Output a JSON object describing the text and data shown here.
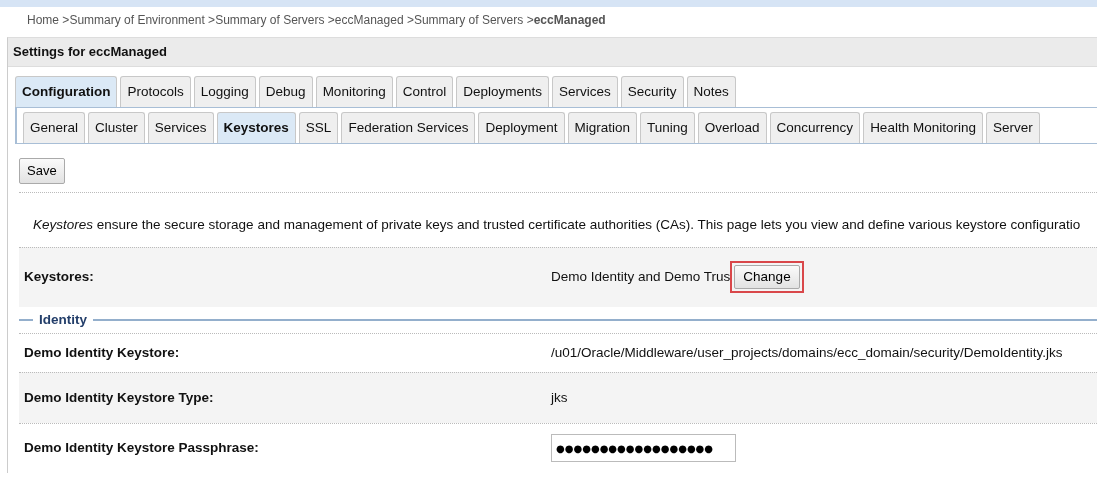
{
  "breadcrumb": [
    {
      "label": "Home",
      "current": false
    },
    {
      "separator": ">",
      "label": "Summary of Environment",
      "current": false
    },
    {
      "separator": ">",
      "label": "Summary of Servers",
      "current": false
    },
    {
      "separator": ">",
      "label": "eccManaged",
      "current": false
    },
    {
      "separator": ">",
      "label": "Summary of Servers",
      "current": false
    },
    {
      "separator": ">",
      "label": "eccManaged",
      "current": true
    }
  ],
  "panel_title": "Settings for eccManaged",
  "tabs": [
    {
      "label": "Configuration",
      "selected": true
    },
    {
      "label": "Protocols",
      "selected": false
    },
    {
      "label": "Logging",
      "selected": false
    },
    {
      "label": "Debug",
      "selected": false
    },
    {
      "label": "Monitoring",
      "selected": false
    },
    {
      "label": "Control",
      "selected": false
    },
    {
      "label": "Deployments",
      "selected": false
    },
    {
      "label": "Services",
      "selected": false
    },
    {
      "label": "Security",
      "selected": false
    },
    {
      "label": "Notes",
      "selected": false
    }
  ],
  "subtabs": [
    {
      "label": "General",
      "selected": false
    },
    {
      "label": "Cluster",
      "selected": false
    },
    {
      "label": "Services",
      "selected": false
    },
    {
      "label": "Keystores",
      "selected": true
    },
    {
      "label": "SSL",
      "selected": false
    },
    {
      "label": "Federation Services",
      "selected": false
    },
    {
      "label": "Deployment",
      "selected": false
    },
    {
      "label": "Migration",
      "selected": false
    },
    {
      "label": "Tuning",
      "selected": false
    },
    {
      "label": "Overload",
      "selected": false
    },
    {
      "label": "Concurrency",
      "selected": false
    },
    {
      "label": "Health Monitoring",
      "selected": false
    },
    {
      "label": "Server",
      "selected": false
    }
  ],
  "save_button": "Save",
  "description": "*Keystores* ensure the secure storage and management of private keys and trusted certificate authorities (CAs). This page lets you view and define various keystore configuratio",
  "keystores": {
    "label": "Keystores:",
    "value": "Demo Identity and Demo Trus",
    "button": "Change",
    "highlighted": true
  },
  "sections": [
    {
      "title": "Identity",
      "rows": [
        {
          "kind": "text",
          "label": "Demo Identity Keystore:",
          "value": "/u01/Oracle/Middleware/user_projects/domains/ecc_domain/security/DemoIdentity.jks"
        },
        {
          "kind": "text",
          "label": "Demo Identity Keystore Type:",
          "value": "jks"
        },
        {
          "kind": "password",
          "label": "Demo Identity Keystore Passphrase:",
          "value": "●●●●●●●●●●●●●●●●●●"
        }
      ]
    }
  ]
}
